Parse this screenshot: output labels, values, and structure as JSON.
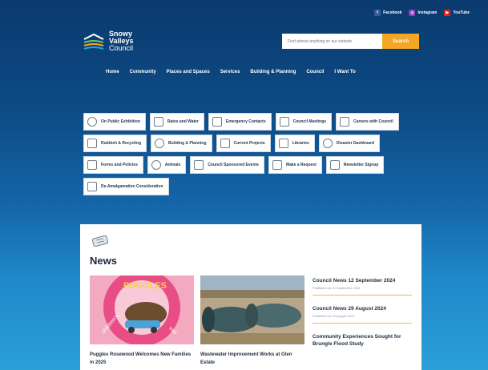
{
  "social": [
    {
      "label": "Facebook",
      "icon": "facebook-icon",
      "color": "#3b5998"
    },
    {
      "label": "Instagram",
      "icon": "instagram-icon",
      "color": "#8a3ab9"
    },
    {
      "label": "YouTube",
      "icon": "youtube-icon",
      "color": "#e62117"
    }
  ],
  "logo": {
    "line1": "Snowy",
    "line2": "Valleys",
    "line3": "Council"
  },
  "search": {
    "placeholder": "Find almost anything on our website",
    "button": "Search"
  },
  "nav": [
    "Home",
    "Community",
    "Places and Spaces",
    "Services",
    "Building & Planning",
    "Council",
    "I Want To"
  ],
  "quick_links": [
    {
      "label": "On Public Exhibition",
      "icon": "exhibition-icon"
    },
    {
      "label": "Rates and Water",
      "icon": "rates-icon"
    },
    {
      "label": "Emergency Contacts",
      "icon": "phone-icon"
    },
    {
      "label": "Council Meetings",
      "icon": "meetings-icon"
    },
    {
      "label": "Careers with Council",
      "icon": "careers-icon"
    },
    {
      "label": "Rubbish & Recycling",
      "icon": "bin-icon"
    },
    {
      "label": "Building & Planning",
      "icon": "planning-icon"
    },
    {
      "label": "Current Projects",
      "icon": "projects-icon"
    },
    {
      "label": "Libraries",
      "icon": "library-icon"
    },
    {
      "label": "Disaster Dashboard",
      "icon": "alert-icon"
    },
    {
      "label": "Forms and Policies",
      "icon": "forms-icon"
    },
    {
      "label": "Animals",
      "icon": "paw-icon"
    },
    {
      "label": "Council Sponsored Events",
      "icon": "calendar-icon"
    },
    {
      "label": "Make a Request",
      "icon": "megaphone-icon"
    },
    {
      "label": "Newsletter Signup",
      "icon": "newsletter-icon"
    },
    {
      "label": "De-Amalgamation Consideration",
      "icon": "building-icon"
    }
  ],
  "news": {
    "title": "News",
    "cards": [
      {
        "title": "Puggles Rosewood Welcomes New Families in 2025",
        "image_text": "PUGGLES children's mobile van"
      },
      {
        "title": "Wastewater Improvement Works at Glen Estate"
      }
    ],
    "side": [
      {
        "title": "Council News 12 September 2024",
        "meta": "Published on 12 September 2024"
      },
      {
        "title": "Council News 29 August 2024",
        "meta": "Published on 29 August 2024"
      },
      {
        "title": "Community Experiences Sought for Brungle Flood Study",
        "meta": ""
      }
    ]
  },
  "colors": {
    "accent": "#f5a623",
    "navy": "#0a3a6e",
    "sky": "#2a9fd8"
  }
}
